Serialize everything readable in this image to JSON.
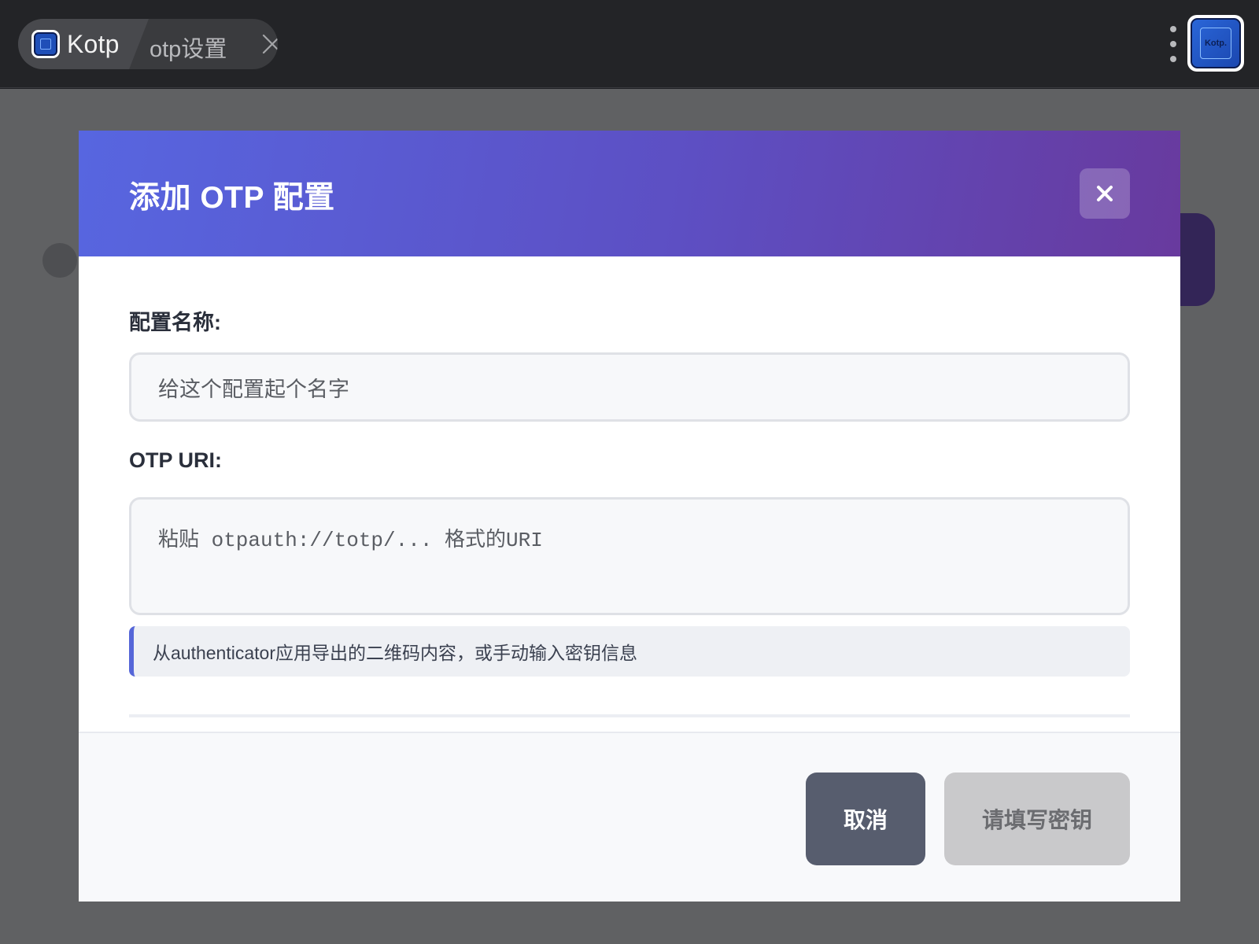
{
  "titlebar": {
    "app_tab_label": "Kotp",
    "page_tab_label": "otp设置",
    "app_logo_icon": "kotp-logo-icon",
    "avatar_logo_text": "Kotp."
  },
  "modal": {
    "title": "添加 OTP 配置",
    "close_icon": "close-icon",
    "name_label": "配置名称:",
    "name_placeholder": "给这个配置起个名字",
    "uri_label": "OTP URI:",
    "uri_placeholder": "粘贴 otpauth://totp/... 格式的URI",
    "hint": "从authenticator应用导出的二维码内容，或手动输入密钥信息",
    "cancel_label": "取消",
    "submit_label": "请填写密钥"
  },
  "colors": {
    "header_gradient_start": "#5766e0",
    "header_gradient_end": "#683a9e",
    "cancel_button": "#575d6e",
    "submit_button_disabled": "#c9c9cb",
    "hint_accent": "#5566d8"
  }
}
